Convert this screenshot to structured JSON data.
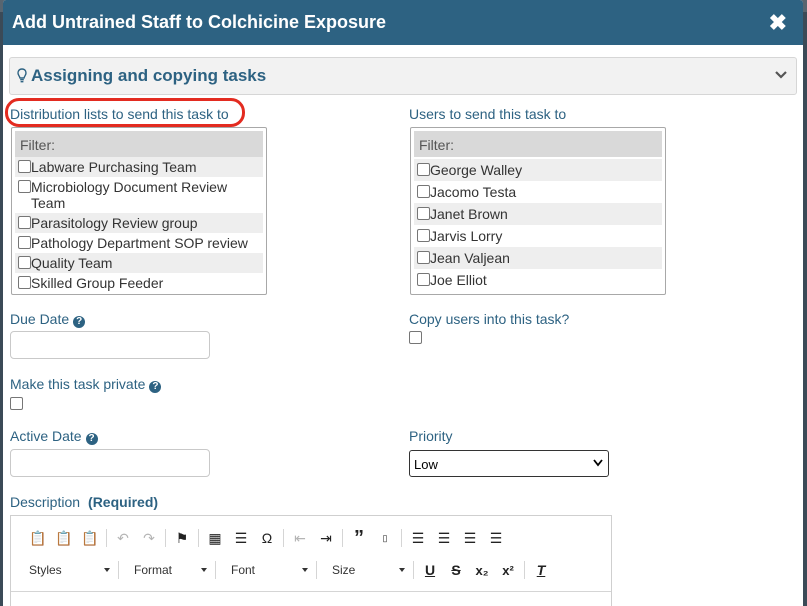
{
  "dialog": {
    "title": "Add Untrained Staff to Colchicine Exposure",
    "close_icon": "close-icon",
    "colors": {
      "header": "#2d6282",
      "accent": "#2d6282",
      "highlight_circle": "#e32b20"
    }
  },
  "section": {
    "title": "Assigning and copying tasks",
    "icon": "lightbulb-icon",
    "toggle_icon": "chevron-down-icon"
  },
  "distribution": {
    "label": "Distribution lists to send this task to",
    "filter": "Filter:",
    "items": [
      "Labware Purchasing Team",
      "Microbiology Document Review Team",
      "Parasitology Review group",
      "Pathology Department SOP review",
      "Quality Team",
      "Skilled Group Feeder"
    ]
  },
  "users": {
    "label": "Users to send this task to",
    "filter": "Filter:",
    "items": [
      "George Walley",
      "Jacomo Testa",
      "Janet Brown",
      "Jarvis Lorry",
      "Jean Valjean",
      "Joe Elliot"
    ]
  },
  "due_date": {
    "label": "Due Date",
    "value": "",
    "help_icon": "question-circle-icon"
  },
  "copy_users": {
    "label": "Copy users into this task?"
  },
  "private_task": {
    "label": "Make this task private",
    "help_icon": "question-circle-icon"
  },
  "active_date": {
    "label": "Active Date",
    "value": "",
    "help_icon": "question-circle-icon"
  },
  "priority": {
    "label": "Priority",
    "selected": "Low"
  },
  "description": {
    "label": "Description",
    "required": "(Required)",
    "toolbar": {
      "row1_icons": [
        "paste-icon",
        "paste-text-icon",
        "paste-word-icon",
        "undo-icon",
        "redo-icon",
        "anchor-flag-icon",
        "table-icon",
        "horizontal-rule-icon",
        "special-char-icon",
        "outdent-icon",
        "indent-icon",
        "blockquote-icon",
        "div-icon",
        "align-left-icon",
        "align-center-icon",
        "align-right-icon",
        "justify-icon"
      ],
      "styles": "Styles",
      "format": "Format",
      "font": "Font",
      "size": "Size",
      "row2_icons": [
        "underline-icon",
        "strikethrough-icon",
        "subscript-icon",
        "superscript-icon",
        "remove-format-icon"
      ]
    }
  }
}
